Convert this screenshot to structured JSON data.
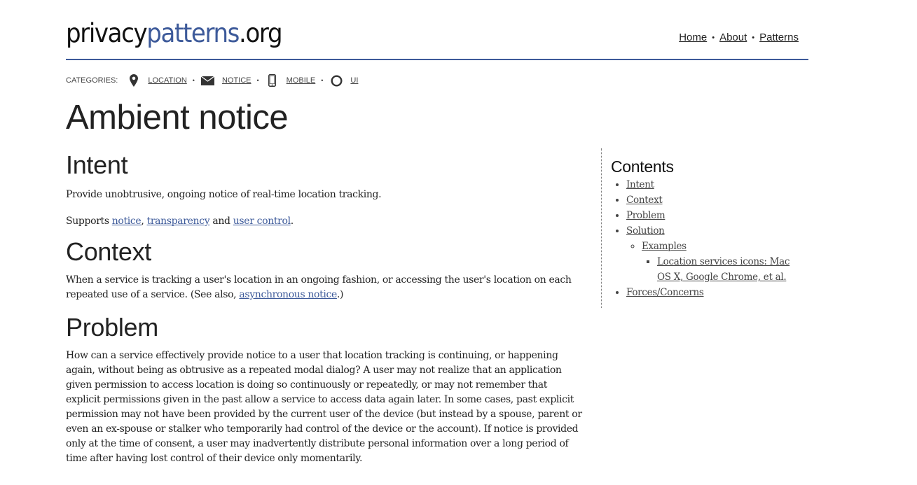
{
  "header": {
    "logo_part1": "privacy",
    "logo_part2": "patterns",
    "logo_part3": ".org",
    "accent_color": "#3d5a9a",
    "nav": [
      {
        "label": "Home"
      },
      {
        "label": "About"
      },
      {
        "label": "Patterns"
      }
    ],
    "nav_separator": "•"
  },
  "categories": {
    "label": "CATEGORIES:",
    "separator": "•",
    "items": [
      {
        "label": "LOCATION",
        "icon": "map-pin-icon"
      },
      {
        "label": "NOTICE",
        "icon": "envelope-icon"
      },
      {
        "label": "MOBILE",
        "icon": "mobile-phone-icon"
      },
      {
        "label": "UI",
        "icon": "circle-icon"
      }
    ]
  },
  "page": {
    "title": "Ambient notice"
  },
  "sections": {
    "intent": {
      "heading": "Intent",
      "text": "Provide unobtrusive, ongoing notice of real-time location tracking.",
      "supports_prefix": "Supports ",
      "supports_links": [
        "notice",
        "transparency",
        "user control"
      ],
      "comma": ", ",
      "and": " and ",
      "period": "."
    },
    "context": {
      "heading": "Context",
      "text_before": "When a service is tracking a user's location in an ongoing fashion, or accessing the user's location on each repeated use of a service. (See also, ",
      "link": "asynchronous notice",
      "text_after": ".)"
    },
    "problem": {
      "heading": "Problem",
      "text": "How can a service effectively provide notice to a user that location tracking is continuing, or happening again, without being as obtrusive as a repeated modal dialog? A user may not realize that an application given permission to access location is doing so continuously or repeatedly, or may not remember that explicit permissions given in the past allow a service to access data again later. In some cases, past explicit permission may not have been provided by the current user of the device (but instead by a spouse, parent or even an ex-spouse or stalker who temporarily had control of the device or the account). If notice is provided only at the time of consent, a user may inadvertently distribute personal information over a long period of time after having lost control of their device only momentarily."
    }
  },
  "toc": {
    "heading": "Contents",
    "items": [
      {
        "label": "Intent"
      },
      {
        "label": "Context"
      },
      {
        "label": "Problem"
      },
      {
        "label": "Solution"
      },
      {
        "label": "Examples"
      },
      {
        "label": "Location services icons: Mac OS X, Google Chrome, et al."
      },
      {
        "label": "Forces/Concerns"
      }
    ]
  }
}
